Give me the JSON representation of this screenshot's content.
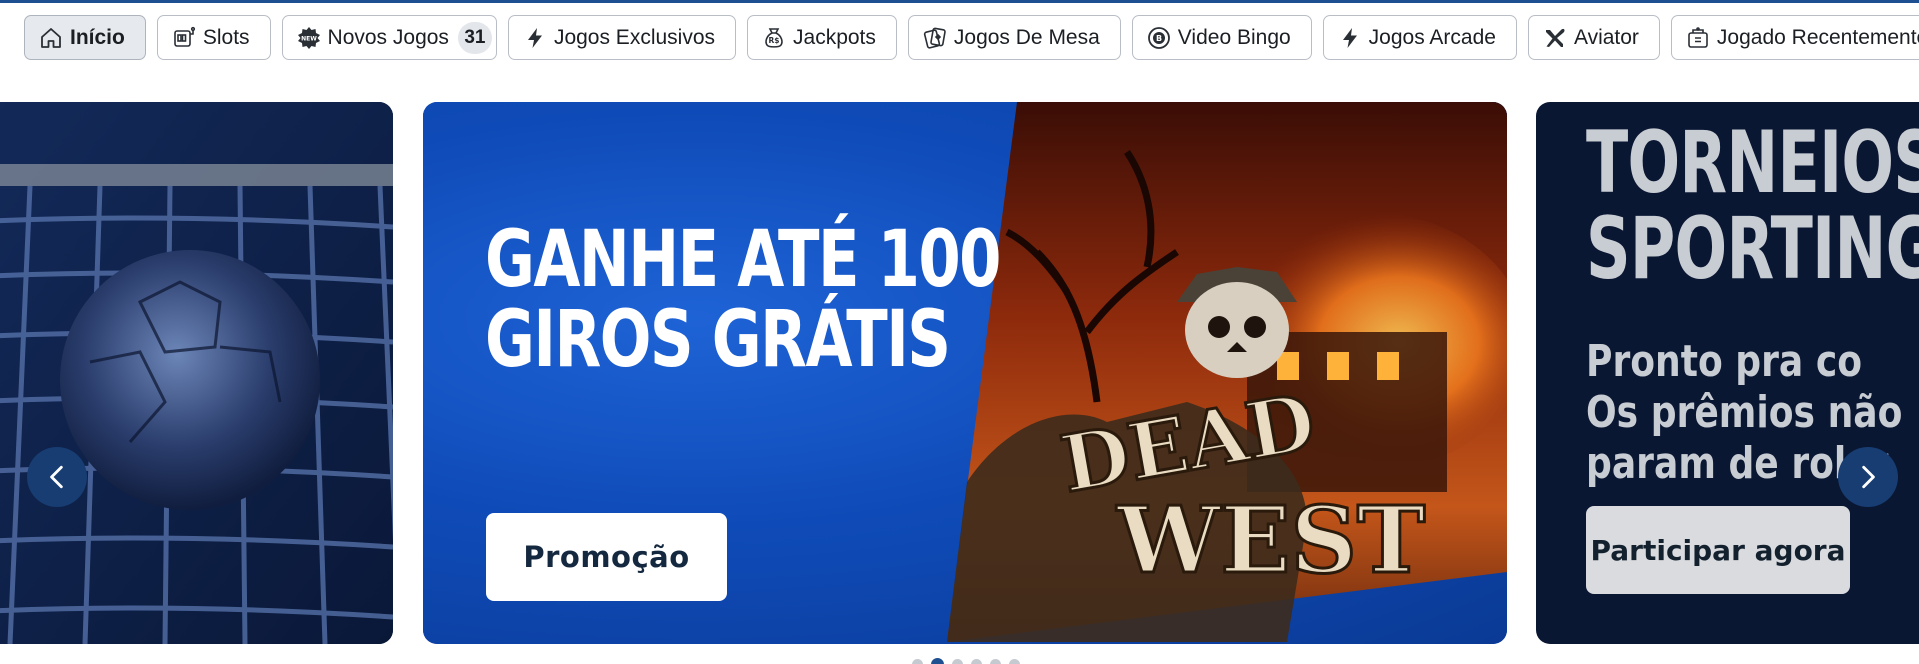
{
  "nav": {
    "chips": [
      {
        "label": "Início",
        "icon": "home-icon",
        "active": true
      },
      {
        "label": "Slots",
        "icon": "slot-machine-icon"
      },
      {
        "label": "Novos Jogos",
        "icon": "new-badge-icon",
        "count": "31"
      },
      {
        "label": "Jogos Exclusivos",
        "icon": "lightning-icon"
      },
      {
        "label": "Jackpots",
        "icon": "money-bag-icon",
        "icon_text": "R$"
      },
      {
        "label": "Jogos De Mesa",
        "icon": "cards-icon"
      },
      {
        "label": "Video Bingo",
        "icon": "bingo-ball-icon"
      },
      {
        "label": "Jogos Arcade",
        "icon": "lightning-icon"
      },
      {
        "label": "Aviator",
        "icon": "plane-icon"
      },
      {
        "label": "Jogado Recentemente",
        "icon": "history-icon"
      }
    ]
  },
  "carousel": {
    "main": {
      "headline_line1": "GANHE ATÉ 100",
      "headline_line2": "GIROS GRÁTIS",
      "cta": "Promoção",
      "logo_line1": "DEAD",
      "logo_line2": "WEST"
    },
    "right": {
      "title_line1": "TORNEIOS",
      "title_line2": "SPORTINGB",
      "sub_line1": "Pronto pra co",
      "sub_line2": "Os prêmios não",
      "sub_line3": "param de rolar",
      "cta": "Participar agora"
    },
    "dots_total": 6,
    "active_dot": 2
  },
  "colors": {
    "accent": "#1d4f91",
    "main_slide_blue": "#0c47b2",
    "arrow_bg": "#173d72"
  }
}
